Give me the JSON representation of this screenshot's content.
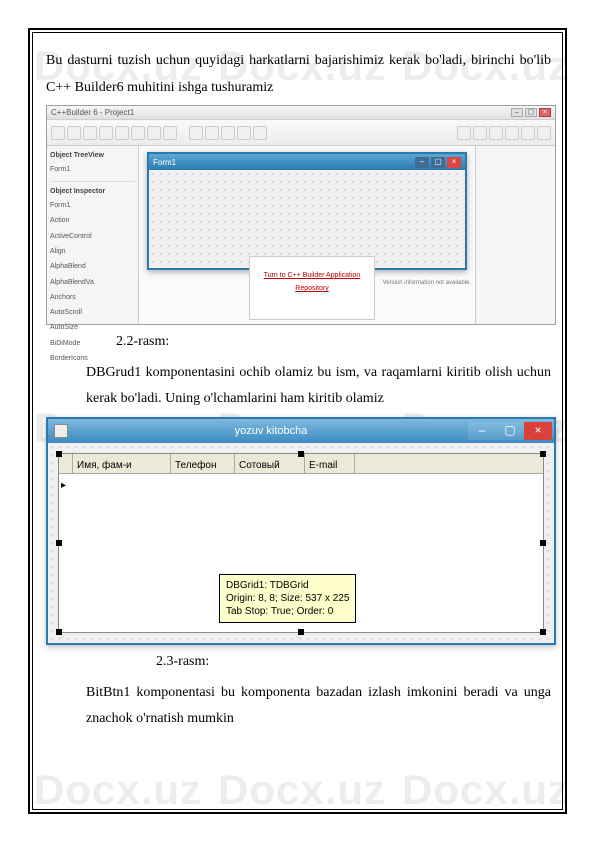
{
  "watermarks": [
    "Docx.uz",
    "Docx.uz",
    "Docx.uz",
    "Docx.uz",
    "Docx.uz",
    "Docx.uz",
    "Docx.uz",
    "Docx.uz",
    "Docx.uz"
  ],
  "para1": "Bu dasturni tuzish uchun quyidagi harkatlarni bajarishimiz kerak bo'ladi, birinchi bo'lib C++ Builder6 muhitini ishga tushuramiz",
  "caption1": "2.2-rasm:",
  "para2": "DBGrud1 komponentasini ochib olamiz bu ism, va raqamlarni kiritib olish uchun kerak bo'ladi. Uning o'lchamlarini ham kiritib olamiz",
  "caption2": "2.3-rasm:",
  "para3": "BitBtn1 komponentasi bu komponenta bazadan izlash imkonini beradi va unga znachok o'rnatish mumkin",
  "ide": {
    "title": "C++Builder 6 - Project1",
    "form_title": "Form1",
    "tree_title": "Object TreeView",
    "tree_item": "Form1",
    "inspector_title": "Object Inspector",
    "inspector_item": "Form1",
    "prop1": "Action",
    "prop2": "ActiveControl",
    "prop3": "Align",
    "prop4": "AlphaBlend",
    "prop5": "AlphaBlendVa",
    "prop6": "Anchors",
    "prop7": "AutoScroll",
    "prop8": "AutoSize",
    "prop9": "BiDiMode",
    "prop10": "BorderIcons",
    "doc_link": "Turn to C++ Builder Application Repository",
    "status": "Version information not available."
  },
  "form2": {
    "title": "yozuv kitobcha",
    "col1": "Имя, фам-и",
    "col2": "Телефон",
    "col3": "Сотовый",
    "col4": "E-mail",
    "tooltip_l1": "DBGrid1: TDBGrid",
    "tooltip_l2": "Origin: 8, 8; Size: 537 x 225",
    "tooltip_l3": "Tab Stop: True; Order: 0"
  }
}
